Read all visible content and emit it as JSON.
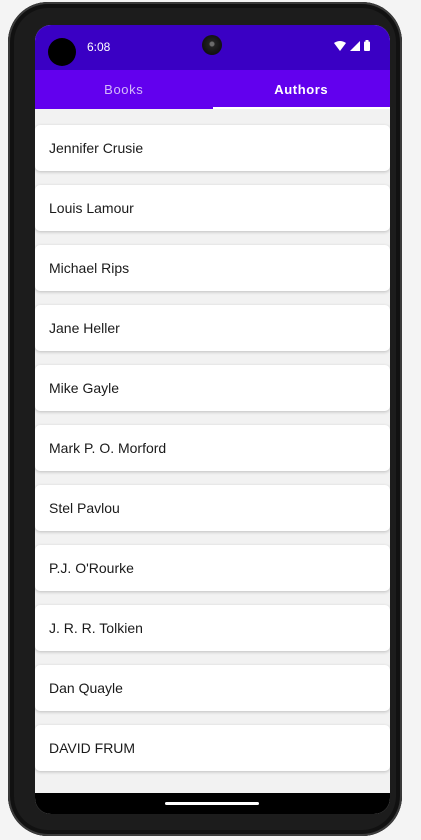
{
  "status_bar": {
    "time": "6:08",
    "icons": [
      "wifi-icon",
      "signal-icon",
      "battery-icon"
    ],
    "color": "#3a00c4"
  },
  "tabs": [
    {
      "label": "Books",
      "active": false
    },
    {
      "label": "Authors",
      "active": true
    }
  ],
  "tab_bar_color": "#6200ee",
  "authors": [
    "Jennifer Crusie",
    "Louis Lamour",
    "Michael Rips",
    "Jane Heller",
    "Mike Gayle",
    "Mark P. O. Morford",
    "Stel Pavlou",
    "P.J. O'Rourke",
    "J. R. R. Tolkien",
    "Dan Quayle",
    "DAVID FRUM"
  ]
}
